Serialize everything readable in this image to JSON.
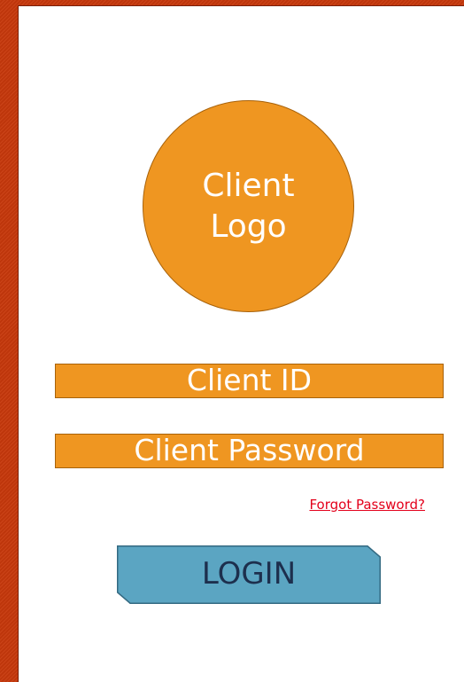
{
  "logo": {
    "text": "Client Logo"
  },
  "form": {
    "client_id_label": "Client ID",
    "client_password_label": "Client Password",
    "forgot_password_link": "Forgot Password?",
    "login_button_label": "LOGIN"
  },
  "colors": {
    "background": "#c8390c",
    "panel": "#ffffff",
    "accent_orange": "#ef9621",
    "link_red": "#e3001b",
    "button_blue": "#5ba5c2",
    "button_text": "#1d2f4d"
  }
}
